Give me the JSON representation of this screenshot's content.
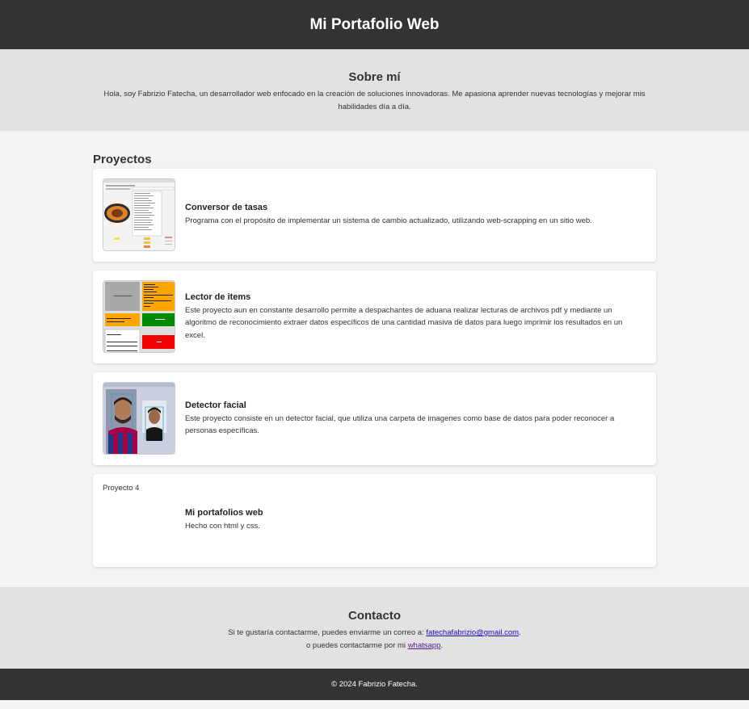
{
  "header": {
    "title": "Mi Portafolio Web"
  },
  "about": {
    "title": "Sobre mí",
    "text": "Hola, soy Fabrizio Fatecha, un desarrollador web enfocado en la creación de soluciones innovadoras. Me apasiona aprender nuevas tecnologías y mejorar mis habilidades día a día."
  },
  "projects": {
    "title": "Proyectos",
    "items": [
      {
        "title": "Conversor de tasas",
        "description": "Programa con el propósito de implementar un sistema de cambio actualizado, utilizando web-scrapping en un sitio web."
      },
      {
        "title": "Lector de items",
        "description": "Este proyecto aun en constante desarrollo permite a despachantes de aduana realizar lecturas de archivos pdf y mediante un algoritmo de reconocimiento extraer datos específicos de una cantidad masiva de datos para luego imprimir los resultados en un excel."
      },
      {
        "title": "Detector facial",
        "description": "Este proyecto consiste en un detector facial, que utiliza una carpeta de imagenes como base de datos para poder reconocer a personas específicas."
      },
      {
        "image_alt": "Proyecto 4",
        "title": "Mi portafolios web",
        "description": "Hecho con html y css."
      }
    ]
  },
  "contact": {
    "title": "Contacto",
    "line1_prefix": "Si te gustaría contactarme, puedes enviarme un correo a: ",
    "email": "fatechafabrizio@gmail.com",
    "line1_suffix": ".",
    "line2_prefix": "o puedes contactarme por mi ",
    "whatsapp": "whatsapp",
    "line2_suffix": "."
  },
  "footer": {
    "text": "© 2024 Fabrizio Fatecha."
  },
  "colors": {
    "dark": "#333333",
    "section_gray": "#e2e2e2",
    "background": "#f4f4f4",
    "link": "#1a0dab",
    "visited_link": "#551a8b"
  }
}
